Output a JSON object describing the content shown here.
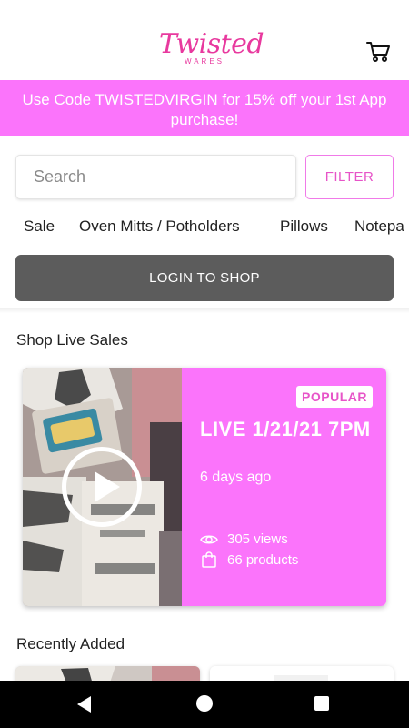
{
  "header": {
    "logo_main": "Twisted",
    "logo_sub": "WARES"
  },
  "promo": {
    "text": "Use Code TWISTEDVIRGIN for 15% off your 1st App purchase!"
  },
  "search": {
    "placeholder": "Search",
    "value": "",
    "filter_label": "FILTER"
  },
  "categories": [
    "Sale",
    "Oven Mitts / Potholders",
    "Pillows",
    "Notepa"
  ],
  "login": {
    "label": "LOGIN TO SHOP"
  },
  "live_sales": {
    "heading": "Shop Live Sales",
    "card": {
      "badge": "POPULAR",
      "title": "LIVE 1/21/21 7PM",
      "ago": "6 days ago",
      "views": "305 views",
      "products": "66 products"
    }
  },
  "recently_added": {
    "heading": "Recently Added"
  },
  "colors": {
    "brand_pink": "#fb74fb",
    "logo_pink": "#e8399e",
    "login_gray": "#5c5c5c"
  }
}
